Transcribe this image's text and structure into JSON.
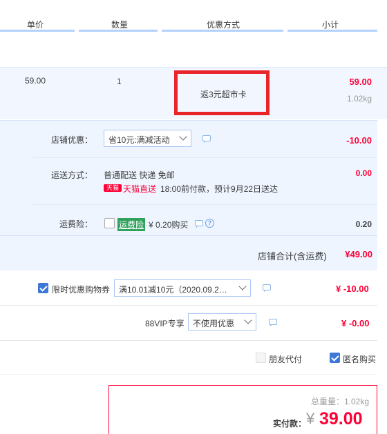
{
  "header": {
    "columns": [
      "单价",
      "数量",
      "优惠方式",
      "小计"
    ]
  },
  "item": {
    "unit_price": "59.00",
    "quantity": "1",
    "promotion": "返3元超市卡",
    "subtotal": "59.00",
    "weight": "1.02kg"
  },
  "shop": {
    "discount": {
      "label": "店铺优惠：",
      "selected": "省10元:满减活动",
      "amount": "-10.00"
    },
    "shipping": {
      "label": "运送方式：",
      "method": "普通配送 快递 免邮",
      "carrier_logo": "天猫",
      "carrier": "天猫直送",
      "eta": "18:00前付款，预计9月22日送达",
      "amount": "0.00"
    },
    "insurance": {
      "label": "运费险：",
      "tag": "运费险",
      "price": "¥ 0.20购买",
      "amount": "0.20",
      "checked": false
    },
    "total": {
      "label": "店铺合计(含运费)",
      "amount": "¥49.00"
    }
  },
  "coupon": {
    "label": "限时优惠购物券",
    "checked": true,
    "selected": "满10.01减10元（2020.09.2…",
    "amount": "¥ -10.00"
  },
  "vip": {
    "label": "88VIP专享",
    "selected": "不使用优惠",
    "amount": "¥ -0.00"
  },
  "options": {
    "friend_pay": "朋友代付",
    "anonymous": "匿名购买",
    "anonymous_checked": true
  },
  "payment": {
    "total_weight": "总重量：1.02kg",
    "label": "实付款：",
    "currency": "¥",
    "amount": "39.00"
  },
  "colors": {
    "accent": "#ff0036",
    "highlight_box": "#e8262a",
    "section_bg": "#eef5ff",
    "checkbox": "#3d78d8"
  },
  "icons": [
    "message-icon",
    "help-icon",
    "chevron-down-icon",
    "checkbox-icon"
  ]
}
